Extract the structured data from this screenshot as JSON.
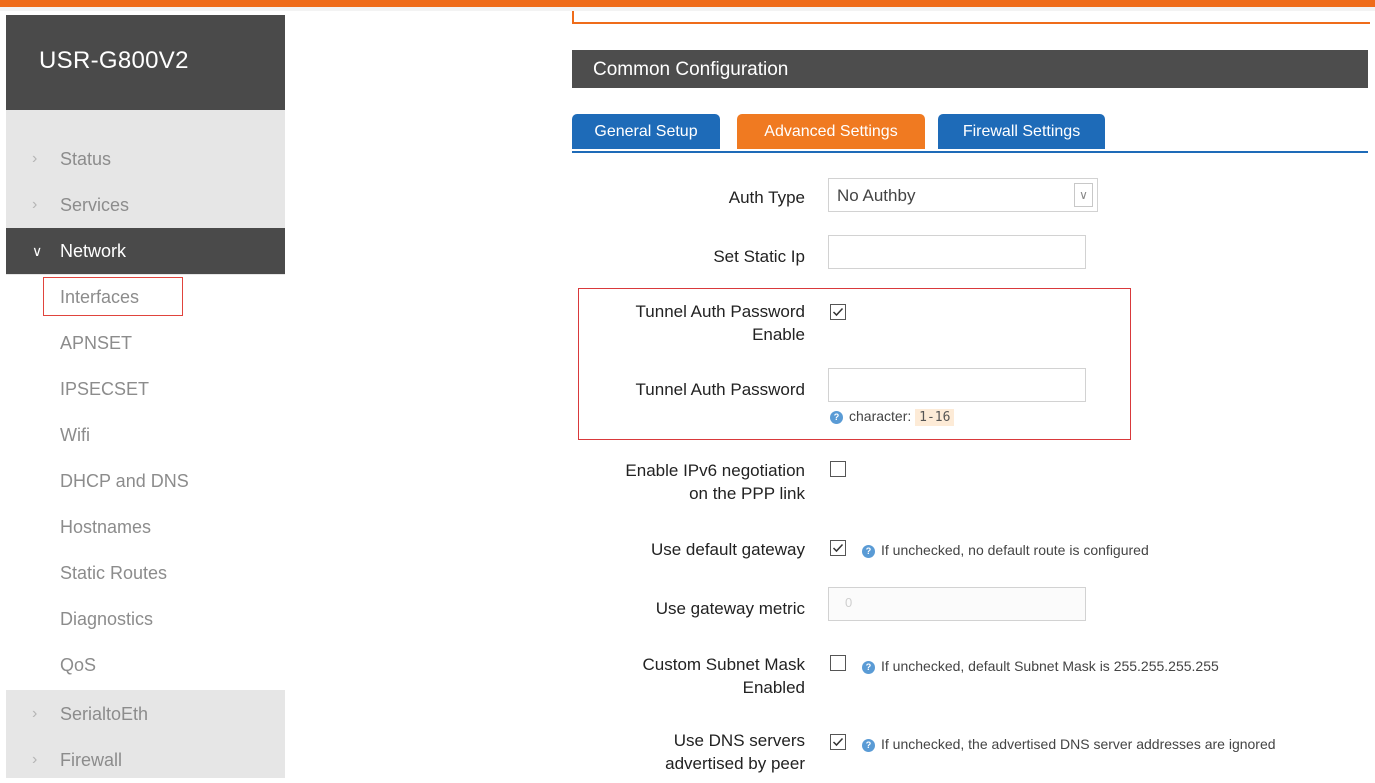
{
  "app": {
    "brand": "USR-G800V2"
  },
  "sidebar": {
    "top_items": [
      {
        "label": "Status",
        "icon": "chevron-right-icon"
      },
      {
        "label": "Services",
        "icon": "chevron-right-icon"
      },
      {
        "label": "Network",
        "icon": "chevron-down-icon",
        "active": true
      }
    ],
    "network_subitems": [
      {
        "label": "Interfaces",
        "highlighted": true
      },
      {
        "label": "APNSET"
      },
      {
        "label": "IPSECSET"
      },
      {
        "label": "Wifi"
      },
      {
        "label": "DHCP and DNS"
      },
      {
        "label": "Hostnames"
      },
      {
        "label": "Static Routes"
      },
      {
        "label": "Diagnostics"
      },
      {
        "label": "QoS"
      }
    ],
    "bottom_items": [
      {
        "label": "SerialtoEth",
        "icon": "chevron-right-icon"
      },
      {
        "label": "Firewall",
        "icon": "chevron-right-icon"
      }
    ]
  },
  "main": {
    "section_title": "Common Configuration",
    "tabs": [
      {
        "label": "General Setup",
        "active": false
      },
      {
        "label": "Advanced Settings",
        "active": true
      },
      {
        "label": "Firewall Settings",
        "active": false
      }
    ],
    "fields": {
      "auth_type": {
        "label": "Auth Type",
        "value": "No Authby"
      },
      "static_ip": {
        "label": "Set Static Ip",
        "value": ""
      },
      "tunnel_auth_enable": {
        "label_line1": "Tunnel Auth Password",
        "label_line2": "Enable",
        "checked": true
      },
      "tunnel_auth_password": {
        "label": "Tunnel Auth Password",
        "value": "",
        "hint_prefix": "character:",
        "hint_value": "1-16"
      },
      "ipv6": {
        "label_line1": "Enable IPv6 negotiation",
        "label_line2": "on the PPP link",
        "checked": false
      },
      "default_gateway": {
        "label": "Use default gateway",
        "checked": true,
        "hint": "If unchecked, no default route is configured"
      },
      "gateway_metric": {
        "label": "Use gateway metric",
        "placeholder": "0"
      },
      "custom_subnet": {
        "label_line1": "Custom Subnet Mask",
        "label_line2": "Enabled",
        "checked": false,
        "hint": "If unchecked, default Subnet Mask is 255.255.255.255"
      },
      "peer_dns": {
        "label_line1": "Use DNS servers",
        "label_line2": "advertised by peer",
        "checked": true,
        "hint": "If unchecked, the advertised DNS server addresses are ignored"
      }
    }
  },
  "colors": {
    "accent_orange": "#f07a21",
    "tab_blue": "#1e6bb8",
    "header_dark": "#4d4d4d",
    "highlight_red": "#d9393b"
  }
}
